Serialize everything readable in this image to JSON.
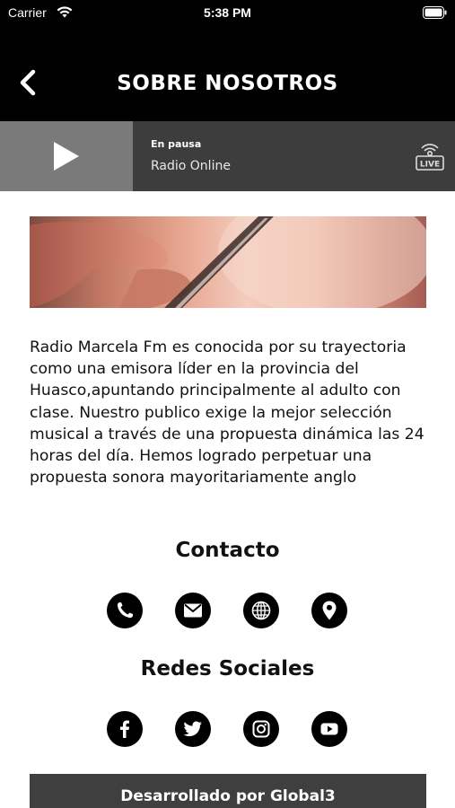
{
  "status_bar": {
    "carrier": "Carrier",
    "time": "5:38 PM"
  },
  "nav": {
    "title": "SOBRE NOSOTROS",
    "back_icon": "chevron-left-icon"
  },
  "player": {
    "status": "En pausa",
    "station": "Radio Online",
    "live_label": "LIVE",
    "play_icon": "play-icon"
  },
  "about": {
    "text": "Radio Marcela Fm es conocida por su trayectoria como una emisora líder en la provincia del Huasco,apuntando principalmente al adulto con clase. Nuestro publico exige la mejor selección musical a través de una propuesta dinámica las 24 horas del día. Hemos logrado perpetuar una propuesta sonora mayoritariamente anglo"
  },
  "contact": {
    "title": "Contacto",
    "icons": [
      "phone-icon",
      "mail-icon",
      "globe-icon",
      "location-pin-icon"
    ]
  },
  "social": {
    "title": "Redes Sociales",
    "icons": [
      "facebook-icon",
      "twitter-icon",
      "instagram-icon",
      "youtube-icon"
    ]
  },
  "footer": {
    "text": "Desarrollado por Global3"
  }
}
